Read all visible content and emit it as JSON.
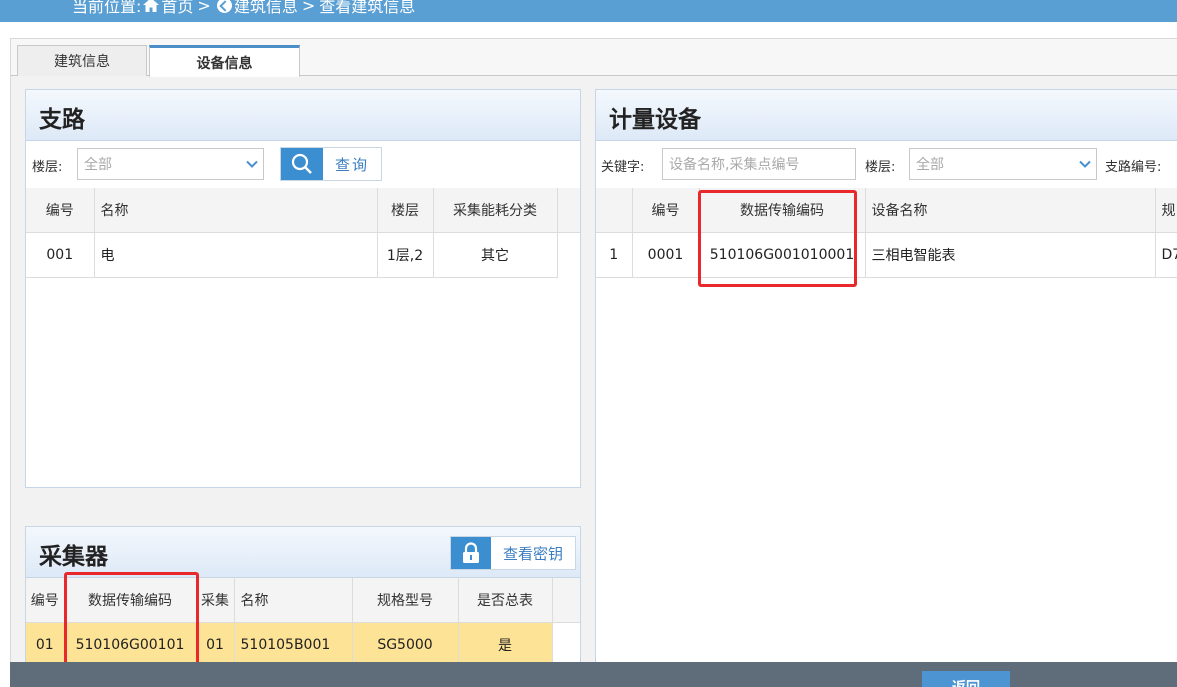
{
  "breadcrumb": {
    "prefix": "当前位置:",
    "home": "首页",
    "sep1": ">",
    "building": "建筑信息",
    "sep2": ">",
    "current": "查看建筑信息"
  },
  "tabs": [
    {
      "label": "建筑信息",
      "active": false
    },
    {
      "label": "设备信息",
      "active": true
    }
  ],
  "branch": {
    "title": "支路",
    "floor_label": "楼层:",
    "floor_value": "全部",
    "query_label": "查询",
    "columns": [
      "编号",
      "名称",
      "楼层",
      "采集能耗分类"
    ],
    "rows": [
      {
        "id": "001",
        "name": "电",
        "floor": "1层,2",
        "category": "其它"
      }
    ]
  },
  "meter": {
    "title": "计量设备",
    "keyword_label": "关键字:",
    "keyword_placeholder": "设备名称,采集点编号",
    "floor_label": "楼层:",
    "floor_value": "全部",
    "branch_label": "支路编号:",
    "columns": [
      "",
      "编号",
      "数据传输编码",
      "设备名称",
      "规"
    ],
    "rows": [
      {
        "idx": "1",
        "id": "0001",
        "code": "510106G001010001",
        "name": "三相电智能表",
        "model": "D7"
      }
    ]
  },
  "collector": {
    "title": "采集器",
    "view_key_label": "查看密钥",
    "columns": [
      "编号",
      "数据传输编码",
      "采集",
      "名称",
      "规格型号",
      "是否总表"
    ],
    "rows": [
      {
        "id": "01",
        "code": "510106G00101",
        "c3": "01",
        "name": "510105B001",
        "model": "SG5000",
        "is_total": "是"
      }
    ]
  },
  "footer": {
    "back_label": "返回"
  },
  "colors": {
    "accent": "#5a9fd4",
    "highlight_row": "#fde396",
    "annotation": "#e8282b"
  }
}
